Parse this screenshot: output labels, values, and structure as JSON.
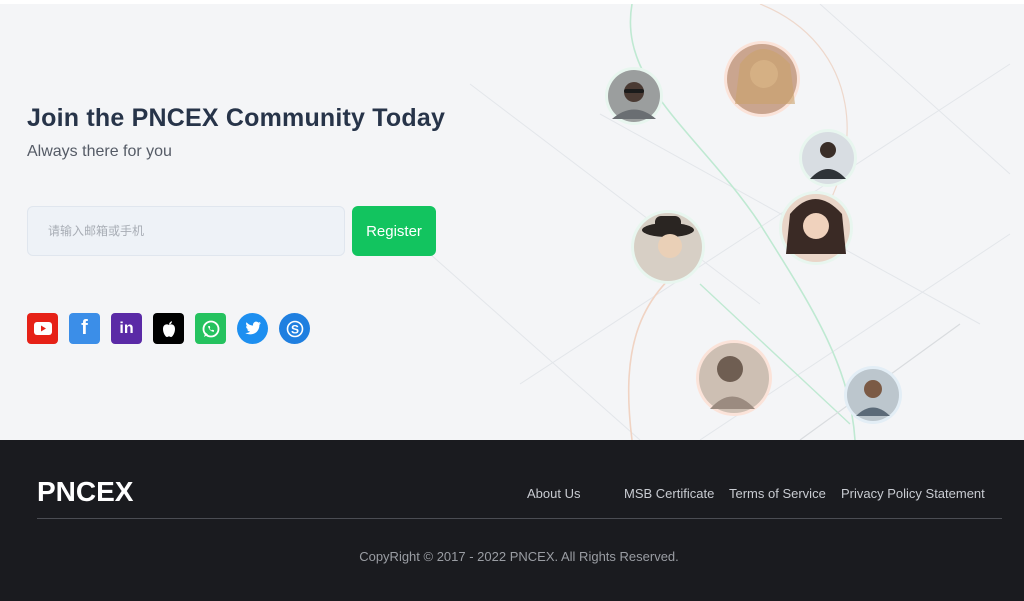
{
  "hero": {
    "title": "Join the PNCEX Community Today",
    "subtitle": "Always there for you",
    "email_placeholder": "请输入邮箱或手机",
    "register_label": "Register",
    "accent_color": "#12c45f"
  },
  "social": [
    {
      "name": "youtube-icon",
      "color": "#e62117"
    },
    {
      "name": "facebook-icon",
      "color": "#3b8ee8"
    },
    {
      "name": "linkedin-icon",
      "color": "#5a2aa6"
    },
    {
      "name": "apple-icon",
      "color": "#000000"
    },
    {
      "name": "whatsapp-icon",
      "color": "#25c25f"
    },
    {
      "name": "twitter-icon",
      "color": "#1d8ff0"
    },
    {
      "name": "skype-icon",
      "color": "#1f7fe0"
    }
  ],
  "footer": {
    "brand": "PNCEX",
    "links": [
      "About Us",
      "MSB Certificate",
      "Terms of Service",
      "Privacy Policy Statement"
    ],
    "copyright": "CopyRight © 2017 - 2022 PNCEX. All Rights Reserved."
  }
}
